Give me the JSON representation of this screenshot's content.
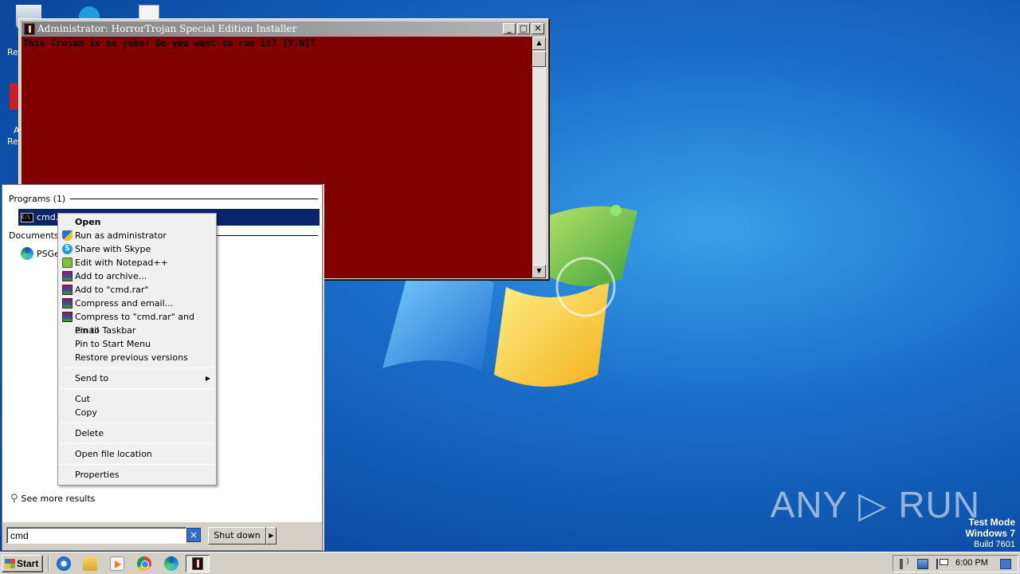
{
  "console": {
    "title": "Administrator:  HorrorTrojan Special Edition Installer",
    "text": "This Trojan is no joke! Do you want to run it? [Y,N]?",
    "minimize": "_",
    "maximize": "□",
    "close": "✕",
    "bg_color": "#800000"
  },
  "start_menu": {
    "programs_header": "Programs (1)",
    "program_item": "cmd.e",
    "documents_header": "Documents (",
    "document_item": "PSGet",
    "see_more": "See more results",
    "search_value": "cmd",
    "clear_icon": "×",
    "shutdown_label": "Shut down",
    "shutdown_arrow": "▶"
  },
  "context_menu": {
    "items": [
      {
        "label": "Open",
        "bold": true,
        "icon": ""
      },
      {
        "label": "Run as administrator",
        "icon": "shield-icon"
      },
      {
        "label": "Share with Skype",
        "icon": "skype-icon"
      },
      {
        "label": "Edit with Notepad++",
        "icon": "notepadpp-icon"
      },
      {
        "label": "Add to archive...",
        "icon": "winrar-icon"
      },
      {
        "label": "Add to \"cmd.rar\"",
        "icon": "winrar-icon"
      },
      {
        "label": "Compress and email...",
        "icon": "winrar-icon"
      },
      {
        "label": "Compress to \"cmd.rar\" and email",
        "icon": "winrar-icon"
      },
      {
        "label": "Pin to Taskbar",
        "icon": ""
      },
      {
        "label": "Pin to Start Menu",
        "icon": ""
      },
      {
        "label": "Restore previous versions",
        "icon": ""
      },
      {
        "label": "Send to",
        "icon": "",
        "submenu": "▶"
      },
      {
        "label": "Cut",
        "icon": ""
      },
      {
        "label": "Copy",
        "icon": ""
      },
      {
        "label": "Delete",
        "icon": ""
      },
      {
        "label": "Open file location",
        "icon": ""
      },
      {
        "label": "Properties",
        "icon": ""
      }
    ]
  },
  "desktop": {
    "watermark": "ANY ▷ RUN",
    "test_mode": "Test Mode",
    "os_name": "Windows 7",
    "build": "Build 7601",
    "icon_labels": [
      "Re",
      "A",
      "Re"
    ]
  },
  "taskbar": {
    "start_label": "Start",
    "clock": "6:00 PM"
  }
}
